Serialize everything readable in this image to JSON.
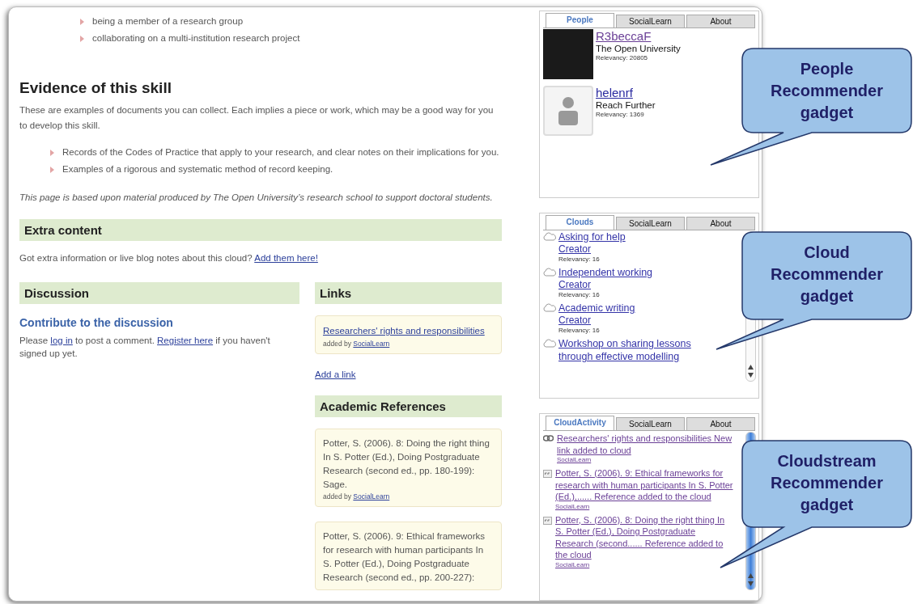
{
  "article": {
    "top_bullets": [
      "being a member of a research group",
      "collaborating on a multi-institution research project"
    ],
    "evidence": {
      "heading": "Evidence of this skill",
      "intro": "These are examples of documents you can collect. Each implies a piece or work, which may be a good way for you to develop this skill.",
      "bullets": [
        "Records of the Codes of Practice that apply to your research, and clear notes on their implications for you.",
        "Examples of a rigorous and systematic method of record keeping."
      ],
      "note": "This page is based upon material produced by The Open University’s research school to support doctoral students."
    },
    "extra": {
      "heading": "Extra content",
      "parts": [
        {
          "kind": "text",
          "text": "Got extra information or live blog notes about this cloud? "
        },
        {
          "kind": "link",
          "text": "Add them here!"
        }
      ]
    },
    "discussion": {
      "heading": "Discussion",
      "subheading": "Contribute to the discussion",
      "parts": [
        {
          "kind": "text",
          "text": "Please "
        },
        {
          "kind": "link",
          "text": "log in"
        },
        {
          "kind": "text",
          "text": " to post a comment. "
        },
        {
          "kind": "link",
          "text": "Register here"
        },
        {
          "kind": "text",
          "text": " if you haven't signed up yet."
        }
      ]
    },
    "links": {
      "heading": "Links",
      "items": [
        {
          "title": "Researchers' rights and responsibilities",
          "added_by": "added by",
          "author": "SocialLearn"
        }
      ],
      "add_link": "Add a link"
    },
    "references": {
      "heading": "Academic References",
      "items": [
        {
          "text": "Potter, S. (2006). 8: Doing the right thing In S. Potter (Ed.), Doing Postgraduate Research (second ed., pp. 180-199): Sage.",
          "added_by": "added by",
          "author": "SocialLearn"
        },
        {
          "text": "Potter, S. (2006). 9: Ethical frameworks for research with human participants In S. Potter (Ed.), Doing Postgraduate Research (second ed., pp. 200-227):"
        }
      ]
    }
  },
  "gadgets": [
    {
      "kind": "people",
      "tabs": [
        {
          "label": "People",
          "selected": true
        },
        {
          "label": "SocialLearn",
          "selected": false
        },
        {
          "label": "About",
          "selected": false
        }
      ],
      "items": [
        {
          "name": "R3beccaF",
          "org": "The Open University",
          "relevancy": "Relevancy: 20805",
          "visited": true,
          "photo": true
        },
        {
          "name": "helenrf",
          "org": "Reach Further",
          "relevancy": "Relevancy: 1369",
          "visited": false,
          "photo": false
        }
      ]
    },
    {
      "kind": "clouds",
      "tabs": [
        {
          "label": "Clouds",
          "selected": true
        },
        {
          "label": "SocialLearn",
          "selected": false
        },
        {
          "label": "About",
          "selected": false
        }
      ],
      "items": [
        {
          "title": "Asking for help",
          "creator": "Creator",
          "relevancy": "Relevancy: 16"
        },
        {
          "title": "Independent working",
          "creator": "Creator",
          "relevancy": "Relevancy: 16"
        },
        {
          "title": "Academic writing",
          "creator": "Creator",
          "relevancy": "Relevancy: 16"
        },
        {
          "title": "Workshop on sharing lessons through effective modelling"
        }
      ]
    },
    {
      "kind": "activity",
      "tabs": [
        {
          "label": "CloudActivity",
          "selected": true
        },
        {
          "label": "SocialLearn",
          "selected": false
        },
        {
          "label": "About",
          "selected": false
        }
      ],
      "items": [
        {
          "kind": "link",
          "text": "Researchers' rights and responsibilities New link added to cloud",
          "source": "SocialLearn"
        },
        {
          "kind": "reference",
          "text": "Potter, S. (2006). 9: Ethical frameworks for research with human participants In S. Potter (Ed.),...... Reference added to the cloud",
          "source": "SocialLearn"
        },
        {
          "kind": "reference",
          "text": "Potter, S. (2006). 8: Doing the right thing In S. Potter (Ed.), Doing Postgraduate Research (second...... Reference added to the cloud",
          "source": "SocialLearn"
        }
      ]
    }
  ],
  "callouts": [
    {
      "text": "People Recommender gadget"
    },
    {
      "text": "Cloud Recommender gadget"
    },
    {
      "text": "Cloudstream Recommender gadget"
    }
  ]
}
